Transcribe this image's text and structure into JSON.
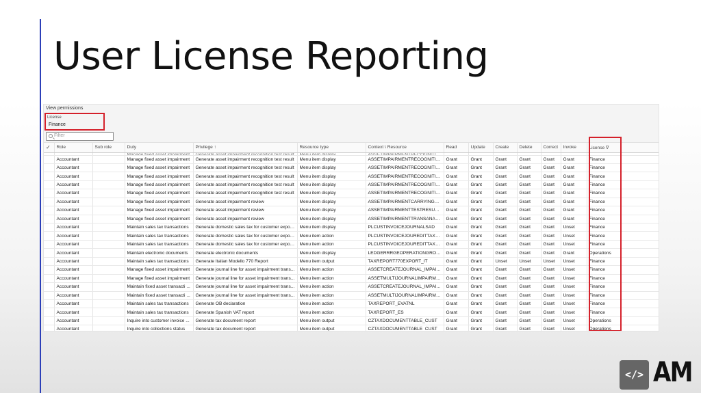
{
  "slide": {
    "title": "User License Reporting"
  },
  "panel": {
    "view_label": "View permissions",
    "license_label": "License",
    "license_value": "Finance",
    "filter_placeholder": "Filter"
  },
  "table": {
    "columns": [
      "",
      "Role",
      "Sub role",
      "Duty",
      "Privilege ↑",
      "Resource type",
      "Context \\ Resource",
      "Read",
      "Update",
      "Create",
      "Delete",
      "Correct",
      "Invoke",
      "License ∇"
    ],
    "partial_row": [
      "",
      "",
      "",
      "Manage fixed asset impairment",
      "Generate asset impairment recognition test result",
      "Menu item display",
      "ASSETIMPAIRMENTRECOGNITION_IP",
      "",
      "",
      "",
      "",
      "",
      "",
      ""
    ],
    "rows": [
      [
        "",
        "Accountant",
        "",
        "Manage fixed asset impairment",
        "Generate asset impairment recognition test result",
        "Menu item display",
        "ASSETIMPAIRMENTRECOGNITION_IP",
        "Grant",
        "Grant",
        "Grant",
        "Grant",
        "Grant",
        "Grant",
        "Finance"
      ],
      [
        "",
        "Accountant",
        "",
        "Manage fixed asset impairment",
        "Generate asset impairment recognition test result",
        "Menu item display",
        "ASSETIMPAIRMENTRECOGNITION ...",
        "Grant",
        "Grant",
        "Grant",
        "Grant",
        "Grant",
        "Grant",
        "Finance"
      ],
      [
        "",
        "Accountant",
        "",
        "Manage fixed asset impairment",
        "Generate asset impairment recognition test result",
        "Menu item display",
        "ASSETIMPAIRMENTRECOGNITION ...",
        "Grant",
        "Grant",
        "Grant",
        "Grant",
        "Grant",
        "Grant",
        "Finance"
      ],
      [
        "",
        "Accountant",
        "",
        "Manage fixed asset impairment",
        "Generate asset impairment recognition test result",
        "Menu item display",
        "ASSETIMPAIRMENTRECOGNITIONT...",
        "Grant",
        "Grant",
        "Grant",
        "Grant",
        "Grant",
        "Grant",
        "Finance"
      ],
      [
        "",
        "Accountant",
        "",
        "Manage fixed asset impairment",
        "Generate asset impairment recognition test result",
        "Menu item display",
        "ASSETIMPAIRMENTRECOGNITIONT...",
        "Grant",
        "Grant",
        "Grant",
        "Grant",
        "Grant",
        "Grant",
        "Finance"
      ],
      [
        "",
        "Accountant",
        "",
        "Manage fixed asset impairment",
        "Generate asset impairment review",
        "Menu item display",
        "ASSETIMPAIRMENTCARRYINGCRN ...",
        "Grant",
        "Grant",
        "Grant",
        "Grant",
        "Grant",
        "Grant",
        "Finance"
      ],
      [
        "",
        "Accountant",
        "",
        "Manage fixed asset impairment",
        "Generate asset impairment review",
        "Menu item display",
        "ASSETIMPAIRMENTTESTRESULTENT...",
        "Grant",
        "Grant",
        "Grant",
        "Grant",
        "Grant",
        "Grant",
        "Finance"
      ],
      [
        "",
        "Accountant",
        "",
        "Manage fixed asset impairment",
        "Generate asset impairment review",
        "Menu item display",
        "ASSETIMPAIRMENTTRANSANALYSI ...",
        "Grant",
        "Grant",
        "Grant",
        "Grant",
        "Grant",
        "Grant",
        "Finance"
      ],
      [
        "",
        "Accountant",
        "",
        "Maintain sales tax transactions",
        "Generate domestic sales tax for customer expor...",
        "Menu item display",
        "PLCUSTINVOICEJOURNALSAD",
        "Grant",
        "Grant",
        "Grant",
        "Grant",
        "Grant",
        "Unset",
        "Finance"
      ],
      [
        "",
        "Accountant",
        "",
        "Maintain sales tax transactions",
        "Generate domestic sales tax for customer expor...",
        "Menu item action",
        "PLCUSTINVOICEJOUREDITTAX_TAXIN",
        "Grant",
        "Grant",
        "Grant",
        "Grant",
        "Grant",
        "Unset",
        "Finance"
      ],
      [
        "",
        "Accountant",
        "",
        "Maintain sales tax transactions",
        "Generate domestic sales tax for customer expor...",
        "Menu item action",
        "PLCUSTINVOICEJOUREDITTAX_TAX ...",
        "Grant",
        "Grant",
        "Grant",
        "Grant",
        "Grant",
        "Unset",
        "Finance"
      ],
      [
        "",
        "Accountant",
        "",
        "Maintain electronic documents",
        "Generate electronic documents",
        "Menu item display",
        "LEDGERRRGEOPERATIONGROUPIN ...",
        "Grant",
        "Grant",
        "Grant",
        "Grant",
        "Grant",
        "Grant",
        "Operations"
      ],
      [
        "",
        "Accountant",
        "",
        "Maintain sales tax transactions",
        "Generate Italian Modello 770 Report",
        "Menu item output",
        "TAXREPORT770EXPORT_IT",
        "Grant",
        "Grant",
        "Unset",
        "Unset",
        "Unset",
        "Unset",
        "Finance"
      ],
      [
        "",
        "Accountant",
        "",
        "Manage fixed asset impairment",
        "Generate journal line for asset impairment trans...",
        "Menu item action",
        "ASSETCREATEJOURNAL_IMPAIRME ...",
        "Grant",
        "Grant",
        "Grant",
        "Grant",
        "Grant",
        "Unset",
        "Finance"
      ],
      [
        "",
        "Accountant",
        "",
        "Manage fixed asset impairment",
        "Generate journal line for asset impairment trans...",
        "Menu item action",
        "ASSETMULTIJOURNALIMPAIRMENT...",
        "Grant",
        "Grant",
        "Grant",
        "Grant",
        "Grant",
        "Unset",
        "Finance"
      ],
      [
        "",
        "Accountant",
        "",
        "Maintain fixed asset transacti ...",
        "Generate journal line for asset impairment trans...",
        "Menu item action",
        "ASSETCREATEJOURNAL_IMPAIRME ...",
        "Grant",
        "Grant",
        "Grant",
        "Grant",
        "Grant",
        "Unset",
        "Finance"
      ],
      [
        "",
        "Accountant",
        "",
        "Maintain fixed asset transacti ...",
        "Generate journal line for asset impairment trans...",
        "Menu item action",
        "ASSETMULTIJOURNALIMPAIRMENT...",
        "Grant",
        "Grant",
        "Grant",
        "Grant",
        "Grant",
        "Unset",
        "Finance"
      ],
      [
        "",
        "Accountant",
        "",
        "Maintain sales tax transactions",
        "Generate OB declaration",
        "Menu item action",
        "TAXREPORT_EVATNL",
        "Grant",
        "Grant",
        "Grant",
        "Grant",
        "Grant",
        "Unset",
        "Finance"
      ],
      [
        "",
        "Accountant",
        "",
        "Maintain sales tax transactions",
        "Generate Spanish VAT report",
        "Menu item action",
        "TAXREPORT_ES",
        "Grant",
        "Grant",
        "Grant",
        "Grant",
        "Grant",
        "Unset",
        "Finance"
      ],
      [
        "",
        "Accountant",
        "",
        "Inquire into customer invoice ...",
        "Generate tax document report",
        "Menu item output",
        "CZTAXDOCUMENTTABLE_CUST",
        "Grant",
        "Grant",
        "Grant",
        "Grant",
        "Grant",
        "Unset",
        "Operations"
      ],
      [
        "",
        "Accountant",
        "",
        "Inquire into collections status",
        "Generate tax document report",
        "Menu item output",
        "CZTAXDOCUMENTTABLE_CUST",
        "Grant",
        "Grant",
        "Grant",
        "Grant",
        "Grant",
        "Unset",
        "Operations"
      ]
    ]
  },
  "logo": {
    "icon_text": "</>",
    "text": "AM"
  }
}
